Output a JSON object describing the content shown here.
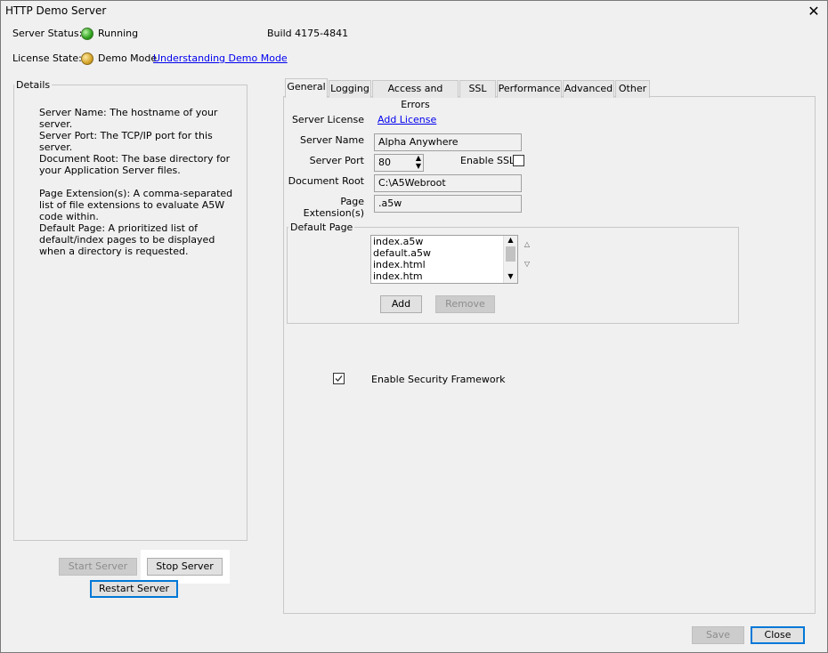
{
  "window": {
    "title": "HTTP Demo Server",
    "close_symbol": "✕"
  },
  "status": {
    "server_status_label": "Server Status:",
    "server_status_value": "Running",
    "build": "Build 4175-4841",
    "license_state_label": "License State:",
    "license_state_value": "Demo Mode",
    "understanding_link": "Understanding Demo Mode"
  },
  "details": {
    "title": "Details",
    "paragraphs": [
      "Server Name: The hostname of your server.",
      "Server Port: The TCP/IP port for this server.",
      "Document Root: The base directory for your Application Server files.",
      "Page Extension(s): A comma-separated list of file extensions to evaluate A5W code within.",
      "Default Page: A prioritized list of default/index pages to be displayed when a directory is requested."
    ]
  },
  "server_buttons": {
    "start": "Start Server",
    "stop": "Stop Server",
    "restart": "Restart Server"
  },
  "tabs": [
    "General",
    "Logging",
    "Access and Errors",
    "SSL",
    "Performance",
    "Advanced",
    "Other"
  ],
  "general": {
    "server_license_label": "Server License",
    "add_license_link": "Add License",
    "server_name_label": "Server Name",
    "server_name_value": "Alpha Anywhere",
    "server_port_label": "Server Port",
    "server_port_value": "80",
    "enable_ssl_label": "Enable SSL",
    "enable_ssl_checked": false,
    "document_root_label": "Document Root",
    "document_root_value": "C:\\A5Webroot",
    "page_ext_label": "Page Extension(s)",
    "page_ext_value": ".a5w",
    "default_page_title": "Default Page",
    "default_pages": [
      "index.a5w",
      "default.a5w",
      "index.html",
      "index.htm"
    ],
    "add_button": "Add",
    "remove_button": "Remove",
    "security_label": "Enable Security Framework",
    "security_checked": true
  },
  "footer": {
    "save": "Save",
    "close": "Close"
  },
  "colors": {
    "focus_border": "#0078d7",
    "link": "#0000ee",
    "running": "#2fa01e",
    "demo": "#d6a52a"
  }
}
